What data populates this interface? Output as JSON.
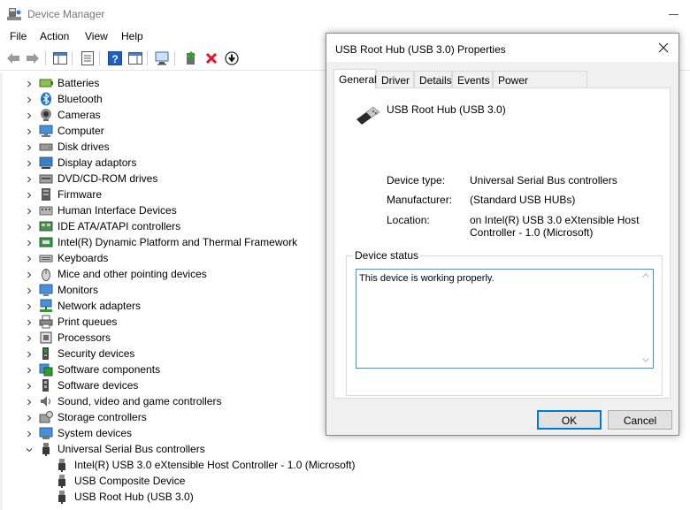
{
  "window": {
    "title": "Device Manager"
  },
  "menu": {
    "file": "File",
    "action": "Action",
    "view": "View",
    "help": "Help"
  },
  "toolbar": {
    "buttons": [
      "back-icon",
      "forward-icon",
      "show-hide-console-tree-icon",
      "properties-icon",
      "help-icon",
      "action-pane-icon",
      "scan-hardware-icon",
      "update-driver-icon",
      "uninstall-icon",
      "disable-icon"
    ]
  },
  "tree": {
    "categories": [
      {
        "label": "Batteries",
        "icon": "battery-icon",
        "expanded": false
      },
      {
        "label": "Bluetooth",
        "icon": "bluetooth-icon",
        "expanded": false
      },
      {
        "label": "Cameras",
        "icon": "camera-icon",
        "expanded": false
      },
      {
        "label": "Computer",
        "icon": "computer-icon",
        "expanded": false
      },
      {
        "label": "Disk drives",
        "icon": "disk-drive-icon",
        "expanded": false
      },
      {
        "label": "Display adaptors",
        "icon": "display-adapter-icon",
        "expanded": false
      },
      {
        "label": "DVD/CD-ROM drives",
        "icon": "dvd-drive-icon",
        "expanded": false
      },
      {
        "label": "Firmware",
        "icon": "firmware-icon",
        "expanded": false
      },
      {
        "label": "Human Interface Devices",
        "icon": "hid-icon",
        "expanded": false
      },
      {
        "label": "IDE ATA/ATAPI controllers",
        "icon": "ide-controller-icon",
        "expanded": false
      },
      {
        "label": "Intel(R) Dynamic Platform and Thermal Framework",
        "icon": "thermal-framework-icon",
        "expanded": false
      },
      {
        "label": "Keyboards",
        "icon": "keyboard-icon",
        "expanded": false
      },
      {
        "label": "Mice and other pointing devices",
        "icon": "mouse-icon",
        "expanded": false
      },
      {
        "label": "Monitors",
        "icon": "monitor-icon",
        "expanded": false
      },
      {
        "label": "Network adapters",
        "icon": "network-adapter-icon",
        "expanded": false
      },
      {
        "label": "Print queues",
        "icon": "printer-icon",
        "expanded": false
      },
      {
        "label": "Processors",
        "icon": "processor-icon",
        "expanded": false
      },
      {
        "label": "Security devices",
        "icon": "security-device-icon",
        "expanded": false
      },
      {
        "label": "Software components",
        "icon": "software-component-icon",
        "expanded": false
      },
      {
        "label": "Software devices",
        "icon": "software-device-icon",
        "expanded": false
      },
      {
        "label": "Sound, video and game controllers",
        "icon": "sound-icon",
        "expanded": false
      },
      {
        "label": "Storage controllers",
        "icon": "storage-controller-icon",
        "expanded": false
      },
      {
        "label": "System devices",
        "icon": "system-device-icon",
        "expanded": false
      },
      {
        "label": "Universal Serial Bus controllers",
        "icon": "usb-controller-icon",
        "expanded": true
      }
    ],
    "usb_children": [
      {
        "label": "Intel(R) USB 3.0 eXtensible Host Controller - 1.0 (Microsoft)",
        "icon": "usb-plug-icon"
      },
      {
        "label": "USB Composite Device",
        "icon": "usb-plug-icon"
      },
      {
        "label": "USB Root Hub (USB 3.0)",
        "icon": "usb-plug-icon"
      }
    ]
  },
  "dialog": {
    "title": "USB Root Hub (USB 3.0) Properties",
    "tabs": [
      "General",
      "Driver",
      "Details",
      "Events",
      "Power Management"
    ],
    "active_tab": "General",
    "device_name": "USB Root Hub (USB 3.0)",
    "properties": {
      "device_type_label": "Device type:",
      "device_type": "Universal Serial Bus controllers",
      "manufacturer_label": "Manufacturer:",
      "manufacturer": "(Standard USB HUBs)",
      "location_label": "Location:",
      "location": "on Intel(R) USB 3.0 eXtensible Host Controller - 1.0 (Microsoft)"
    },
    "status_legend": "Device status",
    "status_text": "This device is working properly.",
    "ok_label": "OK",
    "cancel_label": "Cancel"
  },
  "colors": {
    "accent": "#0078d7",
    "uninstall_red": "#e81123",
    "scan_green": "#2e9e2e",
    "help_blue": "#1f5fbf"
  }
}
